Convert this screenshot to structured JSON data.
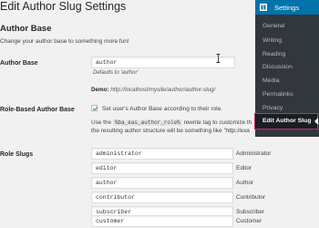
{
  "page": {
    "title": "Edit Author Slug Settings"
  },
  "section": {
    "title": "Author Base",
    "description": "Change your author base to something more fun!"
  },
  "author_base": {
    "label": "Author Base",
    "value": "author",
    "help": "Defaults to 'author'",
    "demo_label": "Demo:",
    "demo_url": "http://localhost/mysite/author/author-slug/"
  },
  "role_based": {
    "label": "Role-Based Author Base",
    "checkbox_label": "Set user's Author Base according to their role.",
    "checked": true,
    "desc_before": "Use the",
    "desc_code": "%ba_eas_author_role%",
    "desc_after": "rewrite tag to customize th",
    "desc_line2_before": "the resulting author structure will be something like",
    "desc_line2_quote": "\"http://exa"
  },
  "role_slugs": {
    "label": "Role Slugs",
    "rows": [
      {
        "slug": "administrator",
        "role": "Administrator"
      },
      {
        "slug": "editor",
        "role": "Editor"
      },
      {
        "slug": "author",
        "role": "Author"
      },
      {
        "slug": "contributor",
        "role": "Contributor"
      },
      {
        "slug": "subscriber",
        "role": "Subscriber"
      },
      {
        "slug": "customer",
        "role": "Customer"
      }
    ]
  },
  "admin_menu": {
    "header": "Settings",
    "items": [
      "General",
      "Writing",
      "Reading",
      "Discussion",
      "Media",
      "Permalinks",
      "Privacy",
      "Edit Author Slug"
    ],
    "active_index": 7,
    "colors": {
      "bg": "#32373c",
      "header": "#0073aa",
      "active_outline": "#c22f6b"
    }
  }
}
